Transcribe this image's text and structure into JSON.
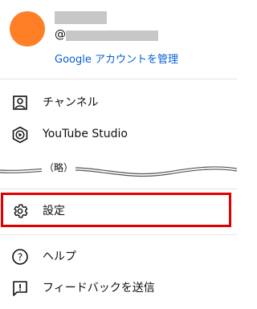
{
  "account": {
    "handle_prefix": "@",
    "manage_link": "Google アカウントを管理",
    "avatar_color": "#ff7f27"
  },
  "menu_top": [
    {
      "label": "チャンネル",
      "icon": "person-box-icon"
    },
    {
      "label": "YouTube Studio",
      "icon": "studio-icon"
    }
  ],
  "omitted_text": "（略）",
  "settings": {
    "label": "設定",
    "icon": "gear-icon",
    "highlight_color": "#e00000"
  },
  "menu_bottom": [
    {
      "label": "ヘルプ",
      "icon": "help-icon"
    },
    {
      "label": "フィードバックを送信",
      "icon": "feedback-icon"
    }
  ],
  "colors": {
    "link": "#065fd4",
    "divider": "#e5e5e5",
    "redaction": "#c7c7c7"
  }
}
